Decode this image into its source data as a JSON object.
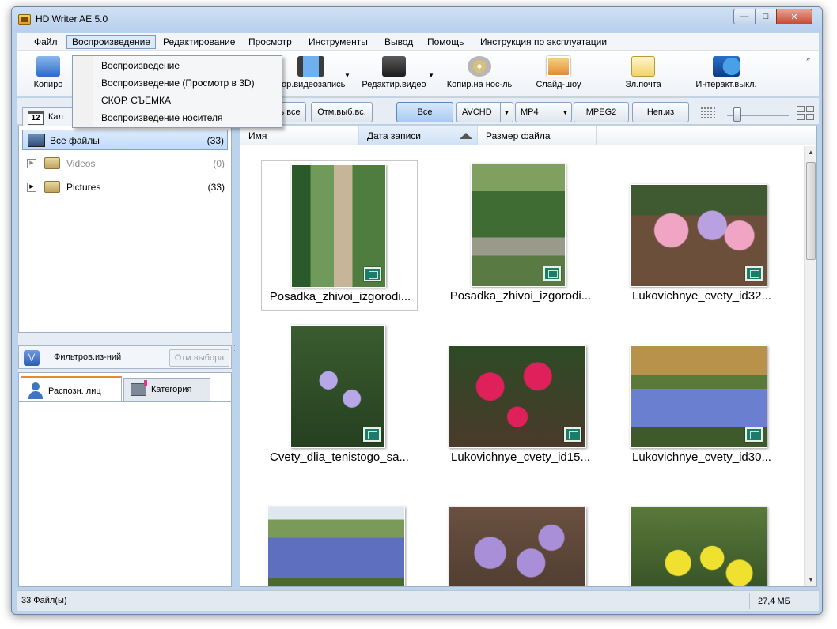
{
  "window": {
    "title": "HD Writer AE 5.0"
  },
  "menu": [
    "Файл",
    "Воспроизведение",
    "Редактирование",
    "Просмотр",
    "Инструменты",
    "Вывод",
    "Помощь",
    "Инструкция по эксплуатации"
  ],
  "playback_menu": {
    "items": [
      "Воспроизведение",
      "Воспроизведение (Просмотр в 3D)",
      "СКОР. СЪЕМКА",
      "Воспроизведение носителя"
    ]
  },
  "toolbar": {
    "copy_label_partial": "Копиро",
    "tools": [
      "Кор.видеозапись",
      "Редактир.видео",
      "Копир.на нос-ль",
      "Слайд-шоу",
      "Эл.почта",
      "Интеракт.выкл."
    ]
  },
  "filterbar": {
    "select_all_partial": "ть все",
    "deselect": "Отм.выб.вс.",
    "all": "Все",
    "avchd": "AVCHD",
    "mp4": "MP4",
    "mpeg2": "MPEG2",
    "unavailable": "Неп.из"
  },
  "leftpanel": {
    "calendar_num": "12",
    "calendar_label_partial": "Кал",
    "tree": [
      {
        "label": "Все файлы",
        "count": "(33)"
      },
      {
        "label": "Videos",
        "count": "(0)"
      },
      {
        "label": "Pictures",
        "count": "(33)"
      }
    ],
    "filter_label": "Фильтров.из-ний",
    "filter_clear": "Отм.выбора",
    "tab_faces": "Распозн. лиц",
    "tab_category": "Категория"
  },
  "columns": [
    "Имя",
    "Дата записи",
    "Размер файла"
  ],
  "files": [
    "Posadka_zhivoi_izgorodi...",
    "Posadka_zhivoi_izgorodi...",
    "Lukovichnye_cvety_id32...",
    "Cvety_dlia_tenistogo_sa...",
    "Lukovichnye_cvety_id15...",
    "Lukovichnye_cvety_id30...",
    "",
    "",
    ""
  ],
  "status": {
    "count": "33 Файл(ы)",
    "size": "27,4 МБ"
  }
}
